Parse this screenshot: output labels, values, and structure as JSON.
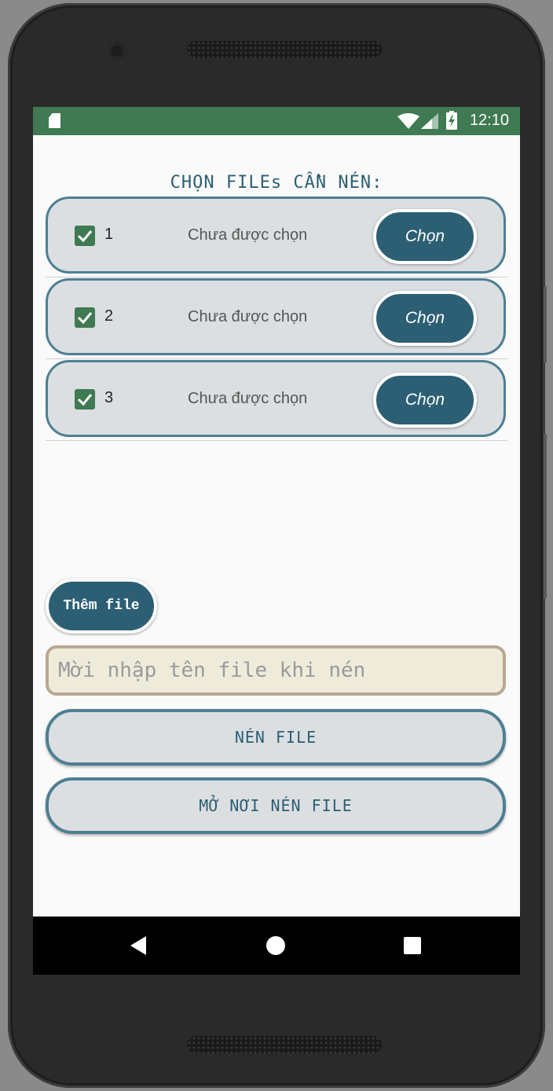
{
  "status_bar": {
    "time": "12:10"
  },
  "title": "CHỌN FILEs CẦN NÉN:",
  "file_rows": [
    {
      "number": "1",
      "status": "Chưa được chọn",
      "checked": true,
      "button": "Chọn"
    },
    {
      "number": "2",
      "status": "Chưa được chọn",
      "checked": true,
      "button": "Chọn"
    },
    {
      "number": "3",
      "status": "Chưa được chọn",
      "checked": true,
      "button": "Chọn"
    }
  ],
  "add_file_button": "Thêm file",
  "file_name_input": {
    "value": "",
    "placeholder": "Mời nhập tên file khi nén"
  },
  "compress_button": "NÉN FILE",
  "open_folder_button": "MỞ NƠI NÉN FILE",
  "colors": {
    "status_bar": "#3f7a52",
    "accent": "#2c5f73",
    "row_border": "#4e7f93",
    "input_background": "#efebdb"
  }
}
